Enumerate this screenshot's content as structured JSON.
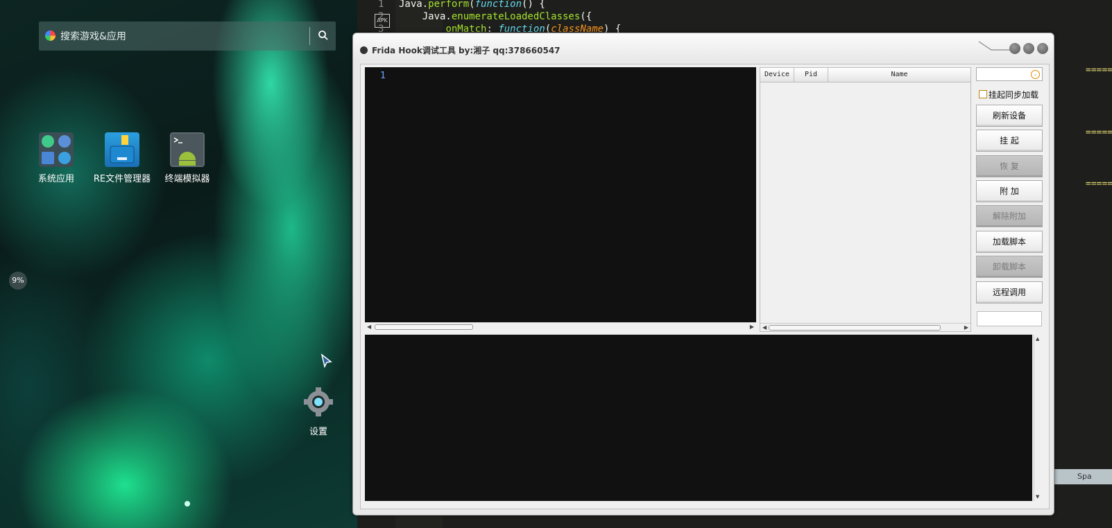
{
  "android": {
    "search_placeholder": "搜索游戏&应用",
    "apps": [
      {
        "label": "系统应用"
      },
      {
        "label": "RE文件管理器"
      },
      {
        "label": "终端模拟器"
      }
    ],
    "memory_badge": "9%",
    "settings_label": "设置"
  },
  "editor": {
    "apk_badge": "APK",
    "lines": [
      {
        "num": "1",
        "parts": [
          [
            "plain",
            "Java."
          ],
          [
            "fn",
            "perform"
          ],
          [
            "plain",
            "("
          ],
          [
            "it",
            "function"
          ],
          [
            "plain",
            "() {"
          ]
        ]
      },
      {
        "num": "2",
        "parts": [
          [
            "plain",
            "    Java."
          ],
          [
            "fn",
            "enumerateLoadedClasses"
          ],
          [
            "plain",
            "({"
          ]
        ]
      },
      {
        "num": "3",
        "parts": [
          [
            "plain",
            "        "
          ],
          [
            "fn",
            "onMatch"
          ],
          [
            "plain",
            ": "
          ],
          [
            "it",
            "function"
          ],
          [
            "plain",
            "("
          ],
          [
            "arg",
            "className"
          ],
          [
            "plain",
            ") {"
          ]
        ]
      }
    ],
    "fragments": [
      "=====",
      "=====",
      "=====\""
    ],
    "status_text": "Spa"
  },
  "frida": {
    "title": "Frida Hook调试工具  by:湘子  qq:378660547",
    "script_line_number": "1",
    "device_columns": [
      "Device",
      "Pid",
      "Name"
    ],
    "combo_arrow": "⌄",
    "suspend_sync_checkbox": "挂起同步加载",
    "buttons": [
      {
        "id": "refresh",
        "label": "刷新设备",
        "enabled": true
      },
      {
        "id": "suspend",
        "label": "挂 起",
        "enabled": true
      },
      {
        "id": "resume",
        "label": "恢 复",
        "enabled": false
      },
      {
        "id": "attach",
        "label": "附 加",
        "enabled": true
      },
      {
        "id": "detach",
        "label": "解除附加",
        "enabled": false
      },
      {
        "id": "load",
        "label": "加载脚本",
        "enabled": true
      },
      {
        "id": "unload",
        "label": "卸载脚本",
        "enabled": false
      },
      {
        "id": "rpc",
        "label": "远程调用",
        "enabled": true
      }
    ]
  }
}
